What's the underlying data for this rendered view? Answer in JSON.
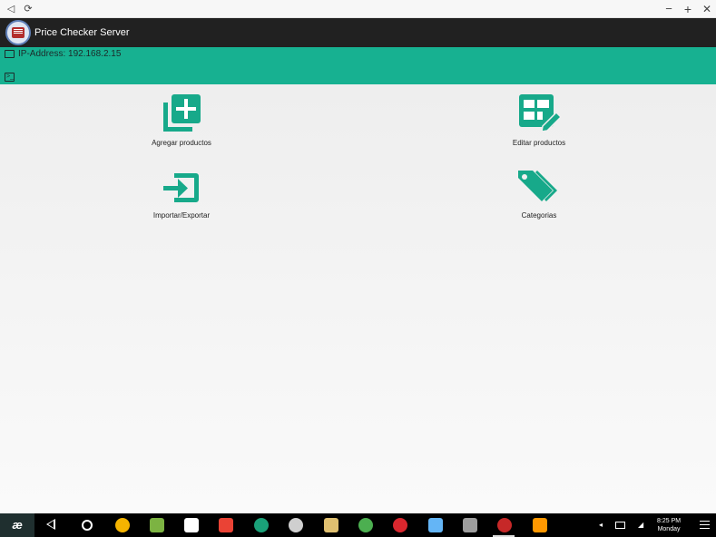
{
  "window": {
    "back_glyph": "◁",
    "rotate_glyph": "⟳",
    "minimize_glyph": "−",
    "maximize_glyph": "+",
    "close_glyph": "✕"
  },
  "appbar": {
    "title": "Price Checker Server"
  },
  "status": {
    "ip_label": "IP-Address: 192.168.2.15",
    "terminal_glyph": ">_"
  },
  "tiles": [
    {
      "label": "Agregar productos",
      "icon": "add-products-icon"
    },
    {
      "label": "Editar productos",
      "icon": "edit-products-icon"
    },
    {
      "label": "Importar/Exportar",
      "icon": "import-export-icon"
    },
    {
      "label": "Categorias",
      "icon": "categories-icon"
    }
  ],
  "taskbar": {
    "start_label": "æ",
    "apps": [
      {
        "name": "keep-icon",
        "color": "#f5b400"
      },
      {
        "name": "android-icon",
        "color": "#7cb342"
      },
      {
        "name": "play-store-icon",
        "color": "#ffffff"
      },
      {
        "name": "gmail-icon",
        "color": "#ea4335"
      },
      {
        "name": "app-green-icon",
        "color": "#1aa179"
      },
      {
        "name": "settings-icon",
        "color": "#cfcfcf"
      },
      {
        "name": "notes-icon",
        "color": "#e0c070"
      },
      {
        "name": "chrome-icon",
        "color": "#4caf50"
      },
      {
        "name": "mega-icon",
        "color": "#d9272e"
      },
      {
        "name": "files-icon",
        "color": "#64b5f6"
      },
      {
        "name": "screen-icon",
        "color": "#9e9e9e"
      },
      {
        "name": "price-checker-icon",
        "color": "#c62828"
      },
      {
        "name": "app-orange-icon",
        "color": "#ff9800"
      }
    ],
    "time": "8:25 PM",
    "day": "Monday"
  },
  "colors": {
    "accent": "#17b191",
    "appbar": "#212121",
    "icon": "#17a98a"
  }
}
